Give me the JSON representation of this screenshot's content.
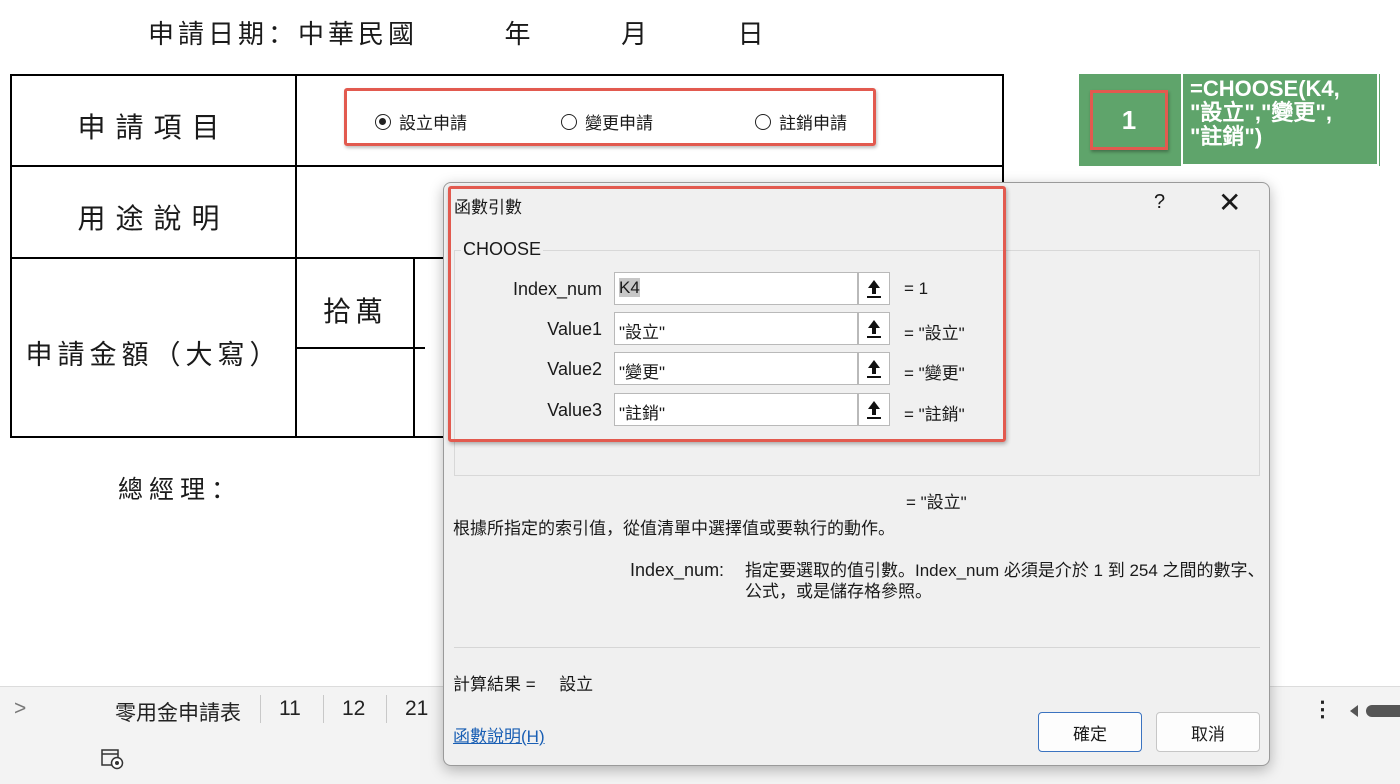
{
  "form": {
    "apply_date": {
      "label": "申請日期：中華民國",
      "year": "年",
      "month": "月",
      "day": "日"
    },
    "rows": {
      "item_label": "申請項目",
      "purpose_label": "用途說明",
      "amount_label": "申請金額（大寫）",
      "unit_label": "拾萬"
    },
    "radio_options": [
      {
        "label": "設立申請",
        "checked": true
      },
      {
        "label": "變更申請",
        "checked": false
      },
      {
        "label": "註銷申請",
        "checked": false
      }
    ],
    "general_manager_label": "總經理："
  },
  "annotation": {
    "cell_value": "1",
    "formula_lines": [
      "=CHOOSE(K4,",
      "\"設立\",\"變更\",",
      "\"註銷\")"
    ],
    "color": "#5fa46b",
    "highlight_color": "#e25a4f"
  },
  "sheet_tabs": {
    "nav_glyph": ">",
    "tabs": [
      "零用金申請表",
      "11",
      "12",
      "21"
    ],
    "more_glyph": "⋮"
  },
  "dialog": {
    "title": "函數引數",
    "help_glyph": "?",
    "close_glyph": "✕",
    "function_name": "CHOOSE",
    "args": [
      {
        "label": "Index_num",
        "value": "K4",
        "result": "=  1",
        "selected": true
      },
      {
        "label": "Value1",
        "value": "\"設立\"",
        "result": "=  \"設立\"",
        "selected": false
      },
      {
        "label": "Value2",
        "value": "\"變更\"",
        "result": "=  \"變更\"",
        "selected": false
      },
      {
        "label": "Value3",
        "value": "\"註銷\"",
        "result": "=  \"註銷\"",
        "selected": false
      }
    ],
    "formula_result": "=  \"設立\"",
    "description": "根據所指定的索引值，從值清單中選擇值或要執行的動作。",
    "arg_help_label": "Index_num:",
    "arg_help_text": "指定要選取的值引數。Index_num 必須是介於 1 到 254 之間的數字、公式，或是儲存格參照。",
    "calc_result_label": "計算結果 =",
    "calc_result_value": "設立",
    "help_link": "函數說明(H)",
    "ok_label": "確定",
    "cancel_label": "取消"
  }
}
